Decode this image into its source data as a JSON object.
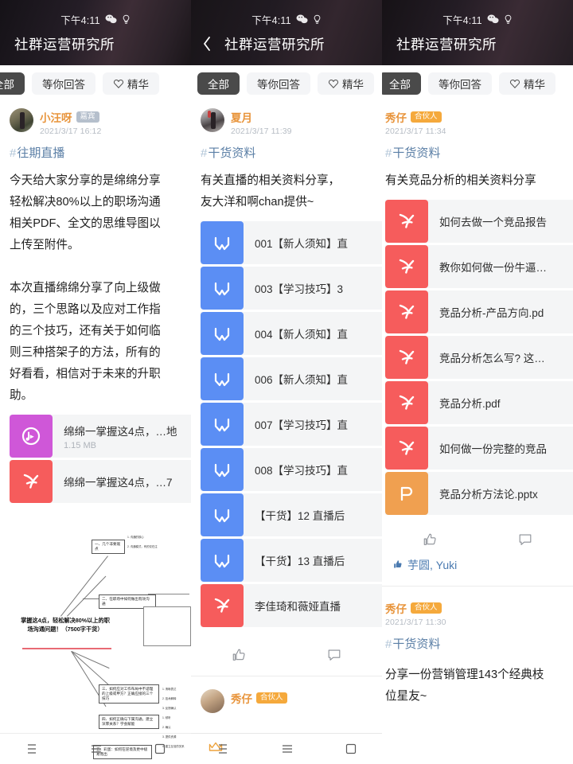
{
  "status": {
    "time": "下午4:11",
    "icons": [
      "wechat-icon",
      "bulb-icon"
    ]
  },
  "header": {
    "title": "社群运营研究所",
    "back_icon": "chevron-left-icon"
  },
  "filters": {
    "items": [
      {
        "label": "全部",
        "active": true,
        "icon": null
      },
      {
        "label": "等你回答",
        "active": false,
        "icon": null
      },
      {
        "label": "精华",
        "active": false,
        "icon": "heart-icon"
      }
    ]
  },
  "panels": [
    {
      "id": "panel-1",
      "has_back": false,
      "posts": [
        {
          "author": "小汪呀",
          "badge": "嘉宾",
          "badge_type": "guest",
          "time": "2021/3/17 16:12",
          "topic": "往期直播",
          "body": "今天给大家分享的是绵绵分享\n轻松解决80%以上的职场沟通\n相关PDF、全文的思维导图以\n上传至附件。\n\n本次直播绵绵分享了向上级做\n的，三个思路以及应对工作指\n的三个技巧，还有关于如何临\n则三种搭架子的方法，所有的\n好看看，相信对于未来的升职\n助。",
          "attachments": [
            {
              "name": "绵绵一掌握这4点，…地",
              "size": "1.15 MB",
              "type": "audio"
            },
            {
              "name": "绵绵一掌握这4点，…7",
              "size": "",
              "type": "pdf"
            }
          ],
          "mindmap": {
            "center": "掌握这4点，轻松解决80%以上的职场沟通问题！（7500字干货）",
            "nodes": [
              "一、几个非要观点",
              "二、在职场中如何做出有效沟通",
              "三、如何应对工作布局中不适理的上级或甲方？正确应接的三个技巧",
              "四、如何正确与下属沟通，建立深厚关系？学会赋能",
              "五、彩蛋：如何在逆境及更中极易而出"
            ],
            "sub_nodes": [
              "1. 沟通的核心",
              "2. 沟通模式，有的仅在注",
              "一、倾斜的核心",
              "二、明确目标的设计",
              "三、工作反馈表",
              "1. 清晰表达",
              "2. 技术解释",
              "3. 反馈确认",
              "1. 倾听",
              "2. 确认",
              "3. 提供资源",
              "4. 建立互信的关系"
            ]
          }
        }
      ]
    },
    {
      "id": "panel-2",
      "has_back": true,
      "posts": [
        {
          "author": "夏月",
          "badge": null,
          "badge_type": null,
          "time": "2021/3/17 11:39",
          "topic": "干货资料",
          "body": "有关直播的相关资料分享，\n友大洋和啊chan提供~",
          "attachments": [
            {
              "name": "001【新人须知】直",
              "size": "",
              "type": "word"
            },
            {
              "name": "003【学习技巧】3",
              "size": "",
              "type": "word"
            },
            {
              "name": "004【新人须知】直",
              "size": "",
              "type": "word"
            },
            {
              "name": "006【新人须知】直",
              "size": "",
              "type": "word"
            },
            {
              "name": "007【学习技巧】直",
              "size": "",
              "type": "word"
            },
            {
              "name": "008【学习技巧】直",
              "size": "",
              "type": "word"
            },
            {
              "name": "【干货】12 直播后",
              "size": "",
              "type": "word"
            },
            {
              "name": "【干货】13 直播后",
              "size": "",
              "type": "word"
            },
            {
              "name": "李佳琦和薇娅直播",
              "size": "",
              "type": "pdf"
            }
          ]
        },
        {
          "author": "秀仔",
          "badge": "合伙人",
          "badge_type": "partner",
          "time": "",
          "topic": "",
          "body": "",
          "attachments": []
        }
      ]
    },
    {
      "id": "panel-3",
      "has_back": false,
      "posts": [
        {
          "author": "秀仔",
          "badge": "合伙人",
          "badge_type": "partner",
          "time": "2021/3/17 11:34",
          "topic": "干货资料",
          "body": "有关竞品分析的相关资料分享",
          "attachments": [
            {
              "name": "如何去做一个竞品报告",
              "size": "",
              "type": "pdf"
            },
            {
              "name": "教你如何做一份牛逼…",
              "size": "",
              "type": "pdf"
            },
            {
              "name": "竞品分析-产品方向.pd",
              "size": "",
              "type": "pdf"
            },
            {
              "name": "竞品分析怎么写? 这…",
              "size": "",
              "type": "pdf"
            },
            {
              "name": "竞品分析.pdf",
              "size": "",
              "type": "pdf"
            },
            {
              "name": "如何做一份完整的竞品",
              "size": "",
              "type": "pdf"
            },
            {
              "name": "竞品分析方法论.pptx",
              "size": "",
              "type": "ppt"
            }
          ],
          "likes": "芋圆, Yuki"
        },
        {
          "author": "秀仔",
          "badge": "合伙人",
          "badge_type": "partner",
          "time": "2021/3/17 11:30",
          "topic": "干货资料",
          "body": "分享一份营销管理143个经典枝\n位星友~",
          "attachments": []
        }
      ]
    }
  ],
  "actions": {
    "like_icon": "thumbs-up-icon",
    "comment_icon": "comment-bubble-icon",
    "liked_by_icon": "thumbs-up-filled-icon"
  },
  "system_nav": {
    "back_icon": "triangle-back-icon",
    "home_icon": "hamburger-home-icon",
    "recents_icon": "square-recents-icon"
  },
  "colors": {
    "accent_orange": "#e8943b",
    "topic_blue": "#5b7fa6",
    "pdf_red": "#f65c5c",
    "word_blue": "#5b8ef4",
    "ppt_orange": "#f0a050",
    "audio_purple": "#cf57d8",
    "active_pill": "#4a4a4a"
  }
}
